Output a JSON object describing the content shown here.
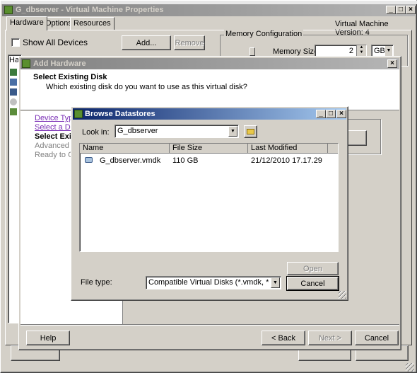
{
  "main_window": {
    "title": "G_dbserver - Virtual Machine Properties",
    "tabs": [
      "Hardware",
      "Options",
      "Resources"
    ],
    "vm_version": "Virtual Machine Version: 4",
    "show_all_devices": "Show All Devices",
    "add_button": "Add...",
    "remove_button": "Remove",
    "memory_group": "Memory Configuration",
    "memory_size_label": "Memory Size:",
    "memory_value": "2",
    "memory_unit": "GB",
    "list_header_fragment": "Ha"
  },
  "add_hardware": {
    "title": "Add Hardware",
    "heading": "Select Existing Disk",
    "subheading": "Which existing disk do you want to use as this virtual disk?",
    "steps": [
      {
        "label": "Device Type"
      },
      {
        "label": "Select a Disk"
      },
      {
        "label": "Select Exis"
      },
      {
        "label": "Advanced O"
      },
      {
        "label": "Ready to Co"
      }
    ],
    "help_button": "Help",
    "back_button": "< Back",
    "next_button": "Next >",
    "cancel_button": "Cancel"
  },
  "browse": {
    "title": "Browse Datastores",
    "look_in_label": "Look in:",
    "look_in_value": "G_dbserver",
    "columns": [
      "Name",
      "File Size",
      "Last Modified"
    ],
    "files": [
      {
        "name": "G_dbserver.vmdk",
        "size": "110 GB",
        "modified": "21/12/2010 17.17.29"
      }
    ],
    "file_type_label": "File type:",
    "file_type_value": "Compatible Virtual Disks (*.vmdk, *.dsk, *.",
    "open_button": "Open",
    "cancel_button": "Cancel"
  },
  "titlebar_buttons": {
    "min": "_",
    "max": "□",
    "close": "×"
  }
}
